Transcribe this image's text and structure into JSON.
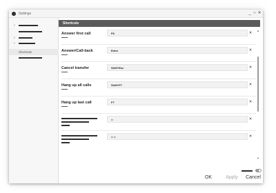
{
  "window": {
    "title": "Settings",
    "controls": {
      "minimize": "_",
      "maximize": "□",
      "close": "✕"
    }
  },
  "sidebar": {
    "items": [
      {
        "chevron": "›",
        "label": ""
      },
      {
        "chevron": "",
        "label": ""
      },
      {
        "chevron": "›",
        "label": ""
      },
      {
        "chevron": "›",
        "label": ""
      },
      {
        "chevron": "",
        "label": "Shortcuts",
        "selected": true
      },
      {
        "chevron": "",
        "label": ""
      }
    ]
  },
  "panel": {
    "header": "Shortcuts",
    "rows": [
      {
        "label": "Answer first call",
        "shortcut": "F8",
        "clear": "✕"
      },
      {
        "label": "Answer/Call-back",
        "shortcut": "Enter",
        "clear": "✕"
      },
      {
        "label": "Cancel transfer",
        "shortcut": "Shift+Esc",
        "clear": "✕"
      },
      {
        "label": "Hang up all calls",
        "shortcut": "Shift+F7",
        "clear": "✕"
      },
      {
        "label": "Hang up last call",
        "shortcut": "F7",
        "clear": "✕"
      },
      {
        "label": "",
        "shortcut": "••",
        "clear": "✕"
      },
      {
        "label": "",
        "shortcut": "•• ••",
        "clear": "✕"
      }
    ]
  },
  "scrollbar": {
    "up": "▲",
    "down": "▼"
  },
  "footer": {
    "ok": "OK",
    "apply": "Apply",
    "cancel": "Cancel"
  },
  "colors": {
    "header_bg": "#5b5b5b",
    "field_bg": "#f2f2f2",
    "apply_disabled": "#aaaaaa"
  }
}
